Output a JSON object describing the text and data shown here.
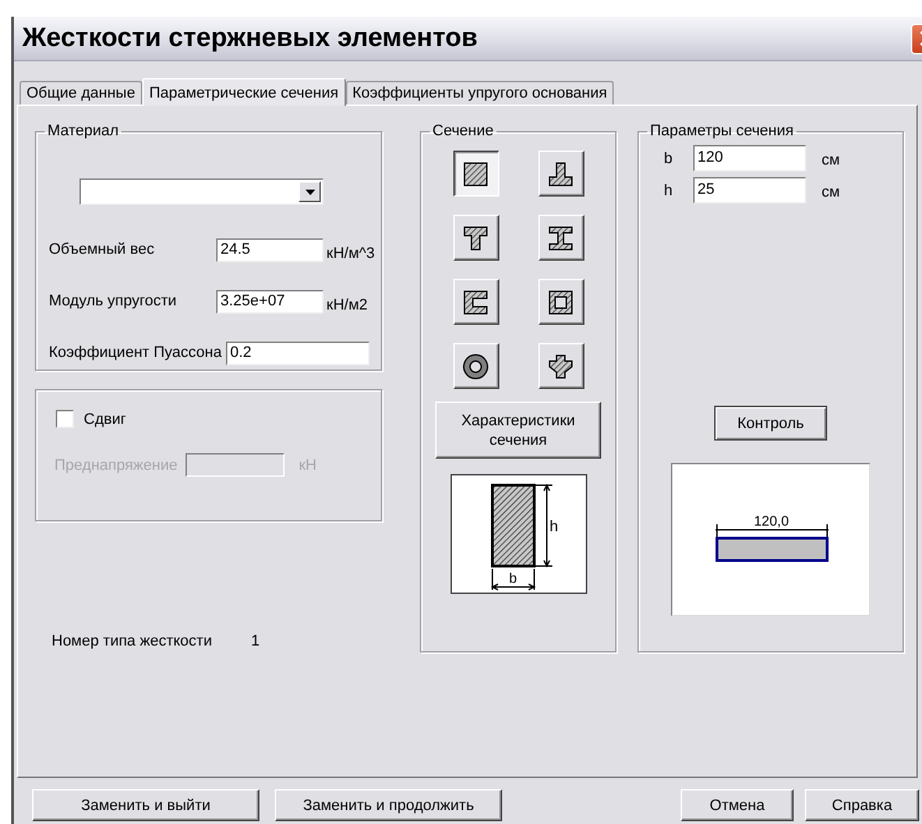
{
  "window": {
    "title": "Жесткости стержневых элементов"
  },
  "tabs": [
    {
      "label": "Общие данные",
      "selected": false
    },
    {
      "label": "Параметрические сечения",
      "selected": true
    },
    {
      "label": "Коэффициенты упругого основания",
      "selected": false
    }
  ],
  "material": {
    "title": "Материал",
    "fields": [
      {
        "label": "Объемный вес",
        "value": "24.5",
        "unit": "кН/м^3"
      },
      {
        "label": "Модуль упругости",
        "value": "3.25e+07",
        "unit": "кН/м2"
      },
      {
        "label": "Коэффициент Пуассона",
        "value": "0.2"
      }
    ]
  },
  "shear": {
    "checkbox": {
      "label": "Сдвиг",
      "checked": false
    },
    "prestress": {
      "label": "Преднапряжение",
      "unit": "кН",
      "disabled": true
    }
  },
  "stiffness_type": {
    "label": "Номер типа жесткости",
    "value": "1"
  },
  "section": {
    "title": "Сечение",
    "shapes": [
      {
        "kind": "rectangle",
        "selected": true
      },
      {
        "kind": "inverted-tee",
        "selected": false
      },
      {
        "kind": "tee",
        "selected": false
      },
      {
        "kind": "i-beam",
        "selected": false
      },
      {
        "kind": "channel",
        "selected": false
      },
      {
        "kind": "box",
        "selected": false
      },
      {
        "kind": "ring",
        "selected": false
      },
      {
        "kind": "cross",
        "selected": false
      }
    ],
    "properties_button": "Характеристики сечения",
    "preview": {
      "height_label": "h",
      "width_label": "b"
    }
  },
  "parameters": {
    "title": "Параметры сечения",
    "fields": [
      {
        "label": "b",
        "value": "120",
        "unit": "см"
      },
      {
        "label": "h",
        "value": "25",
        "unit": "см"
      }
    ],
    "check_button": "Контроль",
    "preview": {
      "dimension": "120,0"
    }
  },
  "buttons": [
    "Заменить и выйти",
    "Заменить и продолжить",
    "Отмена",
    "Справка"
  ]
}
